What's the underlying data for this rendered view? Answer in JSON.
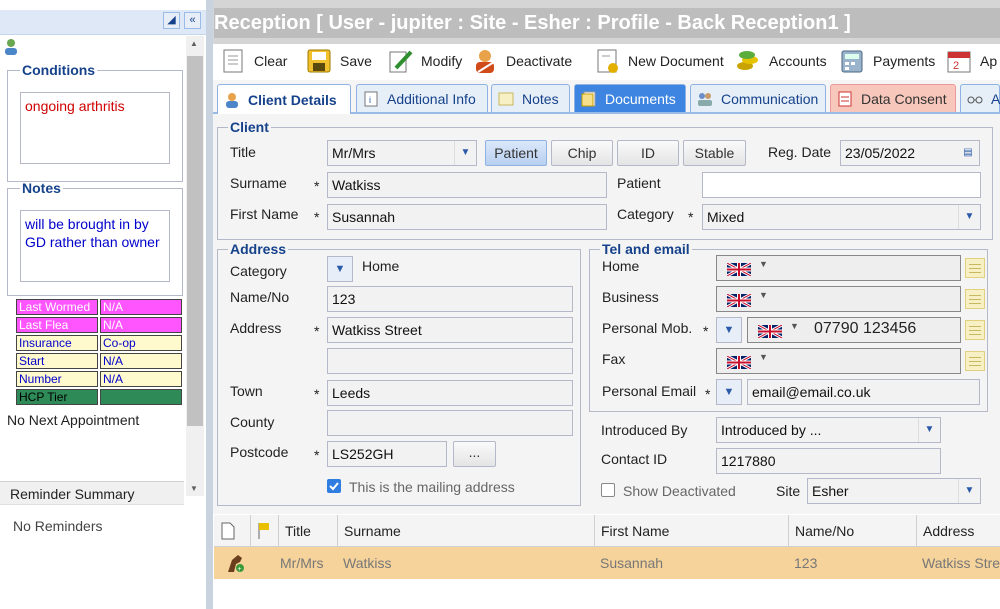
{
  "left": {
    "conditions_legend": "Conditions",
    "conditions_text": "ongoing arthritis",
    "notes_legend": "Notes",
    "notes_text": "will be brought in by GD rather than owner",
    "flags": [
      {
        "key": "Last Wormed",
        "value": "N/A",
        "color": "#ff55ff"
      },
      {
        "key": "Last Flea",
        "value": "N/A",
        "color": "#ff55ff"
      },
      {
        "key": "Insurance",
        "value": "Co-op",
        "color": "#fffacd"
      },
      {
        "key": "Start",
        "value": "N/A",
        "color": "#fffacd"
      },
      {
        "key": "Number",
        "value": "N/A",
        "color": "#fffacd"
      },
      {
        "key": "HCP Tier",
        "value": "",
        "color": "#2e8b57"
      }
    ],
    "next_appointment": "No Next Appointment",
    "reminder_header": "Reminder Summary",
    "reminders": "No Reminders"
  },
  "title": "Reception [ User - jupiter : Site - Esher : Profile - Back Reception1 ]",
  "toolbar": {
    "clear": "Clear",
    "save": "Save",
    "modify": "Modify",
    "deactivate": "Deactivate",
    "new_document": "New Document",
    "accounts": "Accounts",
    "payments": "Payments",
    "ap": "Ap"
  },
  "tabs": {
    "client_details": "Client Details",
    "additional_info": "Additional Info",
    "notes": "Notes",
    "documents": "Documents",
    "communication": "Communication",
    "data_consent": "Data Consent",
    "a": "A"
  },
  "client": {
    "legend": "Client",
    "title_label": "Title",
    "title_value": "Mr/Mrs",
    "patient_btn": "Patient",
    "chip_btn": "Chip",
    "id_btn": "ID",
    "stable_btn": "Stable",
    "reg_date_label": "Reg. Date",
    "reg_date": "23/05/2022",
    "surname_label": "Surname",
    "surname": "Watkiss",
    "first_name_label": "First Name",
    "first_name": "Susannah",
    "patient_label": "Patient",
    "patient": "",
    "category_label": "Category",
    "category": "Mixed"
  },
  "address": {
    "legend": "Address",
    "category_label": "Category",
    "category": "Home",
    "name_no_label": "Name/No",
    "name_no": "123",
    "address_label": "Address",
    "address1": "Watkiss Street",
    "address2": "",
    "town_label": "Town",
    "town": "Leeds",
    "county_label": "County",
    "county": "",
    "postcode_label": "Postcode",
    "postcode": "LS252GH",
    "postcode_btn": "...",
    "mailing_label": "This is the mailing address"
  },
  "tel": {
    "legend": "Tel and email",
    "home_label": "Home",
    "business_label": "Business",
    "mobile_label": "Personal Mob.",
    "mobile": "07790 123456",
    "fax_label": "Fax",
    "email_label": "Personal Email",
    "email": "email@email.co.uk"
  },
  "misc": {
    "introduced_label": "Introduced By",
    "introduced": "Introduced by ...",
    "contact_id_label": "Contact ID",
    "contact_id": "1217880",
    "show_deactivated": "Show Deactivated",
    "site_label": "Site",
    "site": "Esher"
  },
  "grid": {
    "headers": {
      "title": "Title",
      "surname": "Surname",
      "first_name": "First Name",
      "name_no": "Name/No",
      "address": "Address"
    },
    "row": {
      "title": "Mr/Mrs",
      "surname": "Watkiss",
      "first_name": "Susannah",
      "name_no": "123",
      "address": "Watkiss Stree"
    }
  }
}
